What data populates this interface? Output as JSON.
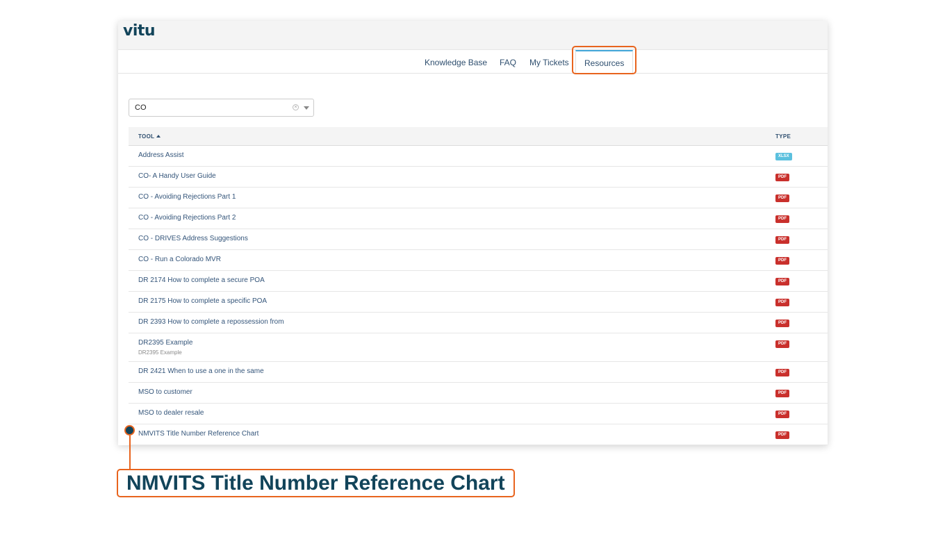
{
  "app": {
    "logo_text": "vitu"
  },
  "nav": {
    "items": [
      {
        "label": "Knowledge Base",
        "active": false
      },
      {
        "label": "FAQ",
        "active": false
      },
      {
        "label": "My Tickets",
        "active": false
      },
      {
        "label": "Resources",
        "active": true
      }
    ]
  },
  "filter": {
    "value": "CO",
    "clear_glyph": "×"
  },
  "table": {
    "columns": [
      {
        "label": "TOOL",
        "sorted": "ascending"
      },
      {
        "label": "TYPE"
      }
    ],
    "rows": [
      {
        "title": "Address Assist",
        "subtitle": "",
        "type": "XLSX"
      },
      {
        "title": "CO- A Handy User Guide",
        "subtitle": "",
        "type": "PDF"
      },
      {
        "title": "CO - Avoiding Rejections Part 1",
        "subtitle": "",
        "type": "PDF"
      },
      {
        "title": "CO - Avoiding Rejections Part 2",
        "subtitle": "",
        "type": "PDF"
      },
      {
        "title": "CO - DRIVES Address Suggestions",
        "subtitle": "",
        "type": "PDF"
      },
      {
        "title": "CO - Run a Colorado MVR",
        "subtitle": "",
        "type": "PDF"
      },
      {
        "title": "DR 2174 How to complete a secure POA",
        "subtitle": "",
        "type": "PDF"
      },
      {
        "title": "DR 2175 How to complete a specific POA",
        "subtitle": "",
        "type": "PDF"
      },
      {
        "title": "DR 2393 How to complete a repossession from",
        "subtitle": "",
        "type": "PDF"
      },
      {
        "title": "DR2395 Example",
        "subtitle": "DR2395 Example",
        "type": "PDF"
      },
      {
        "title": "DR 2421 When to use a one in the same",
        "subtitle": "",
        "type": "PDF"
      },
      {
        "title": "MSO to customer",
        "subtitle": "",
        "type": "PDF"
      },
      {
        "title": "MSO to dealer resale",
        "subtitle": "",
        "type": "PDF"
      },
      {
        "title": "NMVITS Title Number Reference Chart",
        "subtitle": "",
        "type": "PDF"
      }
    ]
  },
  "callout": {
    "text": "NMVITS Title Number Reference Chart"
  },
  "colors": {
    "accent_orange": "#e8641e",
    "brand_navy": "#12445a",
    "tab_accent_blue": "#43a7d9",
    "pdf_badge": "#c9302c",
    "xlsx_badge": "#5bc0de"
  }
}
